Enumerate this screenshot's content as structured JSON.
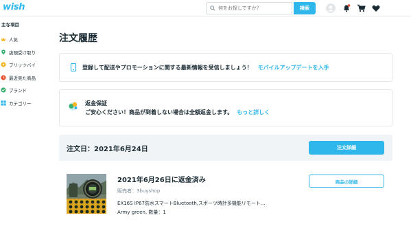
{
  "header": {
    "logo": "wish",
    "search_placeholder": "何をお探しですか？",
    "search_button": "検索",
    "icons": [
      "avatar-icon",
      "bell-icon",
      "cart-icon",
      "heart-icon"
    ],
    "notification_dot_color": "#e74c3c"
  },
  "sidebar": {
    "heading": "主な項目",
    "items": [
      {
        "label": "人気",
        "icon": "crown-icon"
      },
      {
        "label": "店頭受け取り",
        "icon": "location-pin-icon"
      },
      {
        "label": "ブリッツバイ",
        "icon": "blitz-buy-icon"
      },
      {
        "label": "最近見た商品",
        "icon": "clock-icon"
      },
      {
        "label": "ブランド",
        "icon": "verified-badge-icon"
      },
      {
        "label": "カテゴリー",
        "icon": "grid-icon"
      }
    ]
  },
  "main": {
    "title": "注文履歴",
    "promo": {
      "text": "登録して配送やプロモーションに関する最新情報を受信しましょう！",
      "link": "モバイルアップデートを入手"
    },
    "refund": {
      "title": "返金保証",
      "body": "ご安心ください！商品が到着しない場合は全額返金します。",
      "link": "もっと詳しく"
    },
    "order": {
      "date": "注文日：2021年6月24日",
      "details_button": "注文詳細",
      "item": {
        "status": "2021年6月26日に返金済み",
        "seller": "販売者：3buyshop",
        "name": "EX16S IP67防水スマートBluetooth,スポーツ時計多機能リモート...",
        "variant": "Army green, 数量：1",
        "details_button": "商品の詳細"
      }
    }
  },
  "colors": {
    "accent": "#2fb7ec",
    "text": "#192a32",
    "muted": "#7a8c97",
    "order_bar": "#f1f4f6"
  }
}
